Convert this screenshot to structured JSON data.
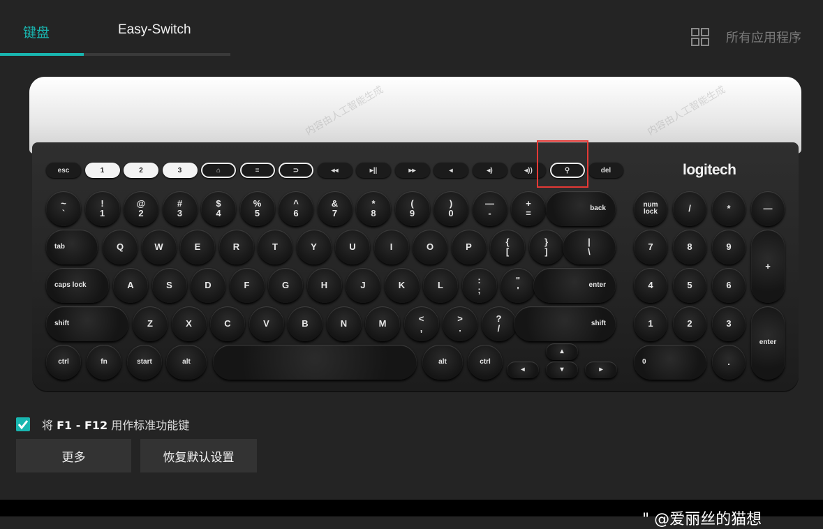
{
  "tabs": [
    {
      "label": "键盘",
      "active": true
    },
    {
      "label": "Easy-Switch",
      "active": false
    }
  ],
  "header": {
    "apps_label": "所有应用程序"
  },
  "keyboard": {
    "brand": "logitech",
    "fn_row": [
      "esc",
      "1",
      "2",
      "3",
      "⌂",
      "≡",
      "⊃",
      "◂◂",
      "▸||",
      "▸▸",
      "◂",
      "◂)",
      "◂))",
      "search",
      "del"
    ],
    "number_row": [
      "~\n`",
      "!\n1",
      "@\n2",
      "#\n3",
      "$\n4",
      "%\n5",
      "^\n6",
      "&\n7",
      "*\n8",
      "(\n9",
      ")\n0",
      "—\n-",
      "+\n=",
      "back"
    ],
    "qwerty_row": [
      "tab",
      "Q",
      "W",
      "E",
      "R",
      "T",
      "Y",
      "U",
      "I",
      "O",
      "P",
      "{\n[",
      "}\n]",
      "|\n\\"
    ],
    "home_row": [
      "caps lock",
      "A",
      "S",
      "D",
      "F",
      "G",
      "H",
      "J",
      "K",
      "L",
      ":\n;",
      "\"\n'",
      "enter"
    ],
    "shift_row": [
      "shift",
      "Z",
      "X",
      "C",
      "V",
      "B",
      "N",
      "M",
      "<\n,",
      ">\n.",
      "?\n/",
      "shift"
    ],
    "bottom_row": [
      "ctrl",
      "fn",
      "start",
      "alt",
      "",
      "alt",
      "ctrl"
    ],
    "numpad": {
      "row1": [
        "num\nlock",
        "/",
        "*",
        "—"
      ],
      "row2": [
        "7",
        "8",
        "9",
        "+"
      ],
      "row3": [
        "4",
        "5",
        "6"
      ],
      "row4": [
        "1",
        "2",
        "3",
        "enter"
      ],
      "row5": [
        "0",
        ".",
        "—"
      ]
    },
    "arrows": [
      "◂",
      "▴",
      "▾",
      "▸"
    ]
  },
  "settings": {
    "f_keys_checkbox": {
      "checked": true,
      "label_prefix": "将 ",
      "label_bold": "F1 - F12",
      "label_suffix": " 用作标准功能键"
    },
    "more_button": "更多",
    "reset_button": "恢复默认设置"
  },
  "watermark": "内容由人工智能生成",
  "footer_text": "\" @爱丽丝的猫想"
}
